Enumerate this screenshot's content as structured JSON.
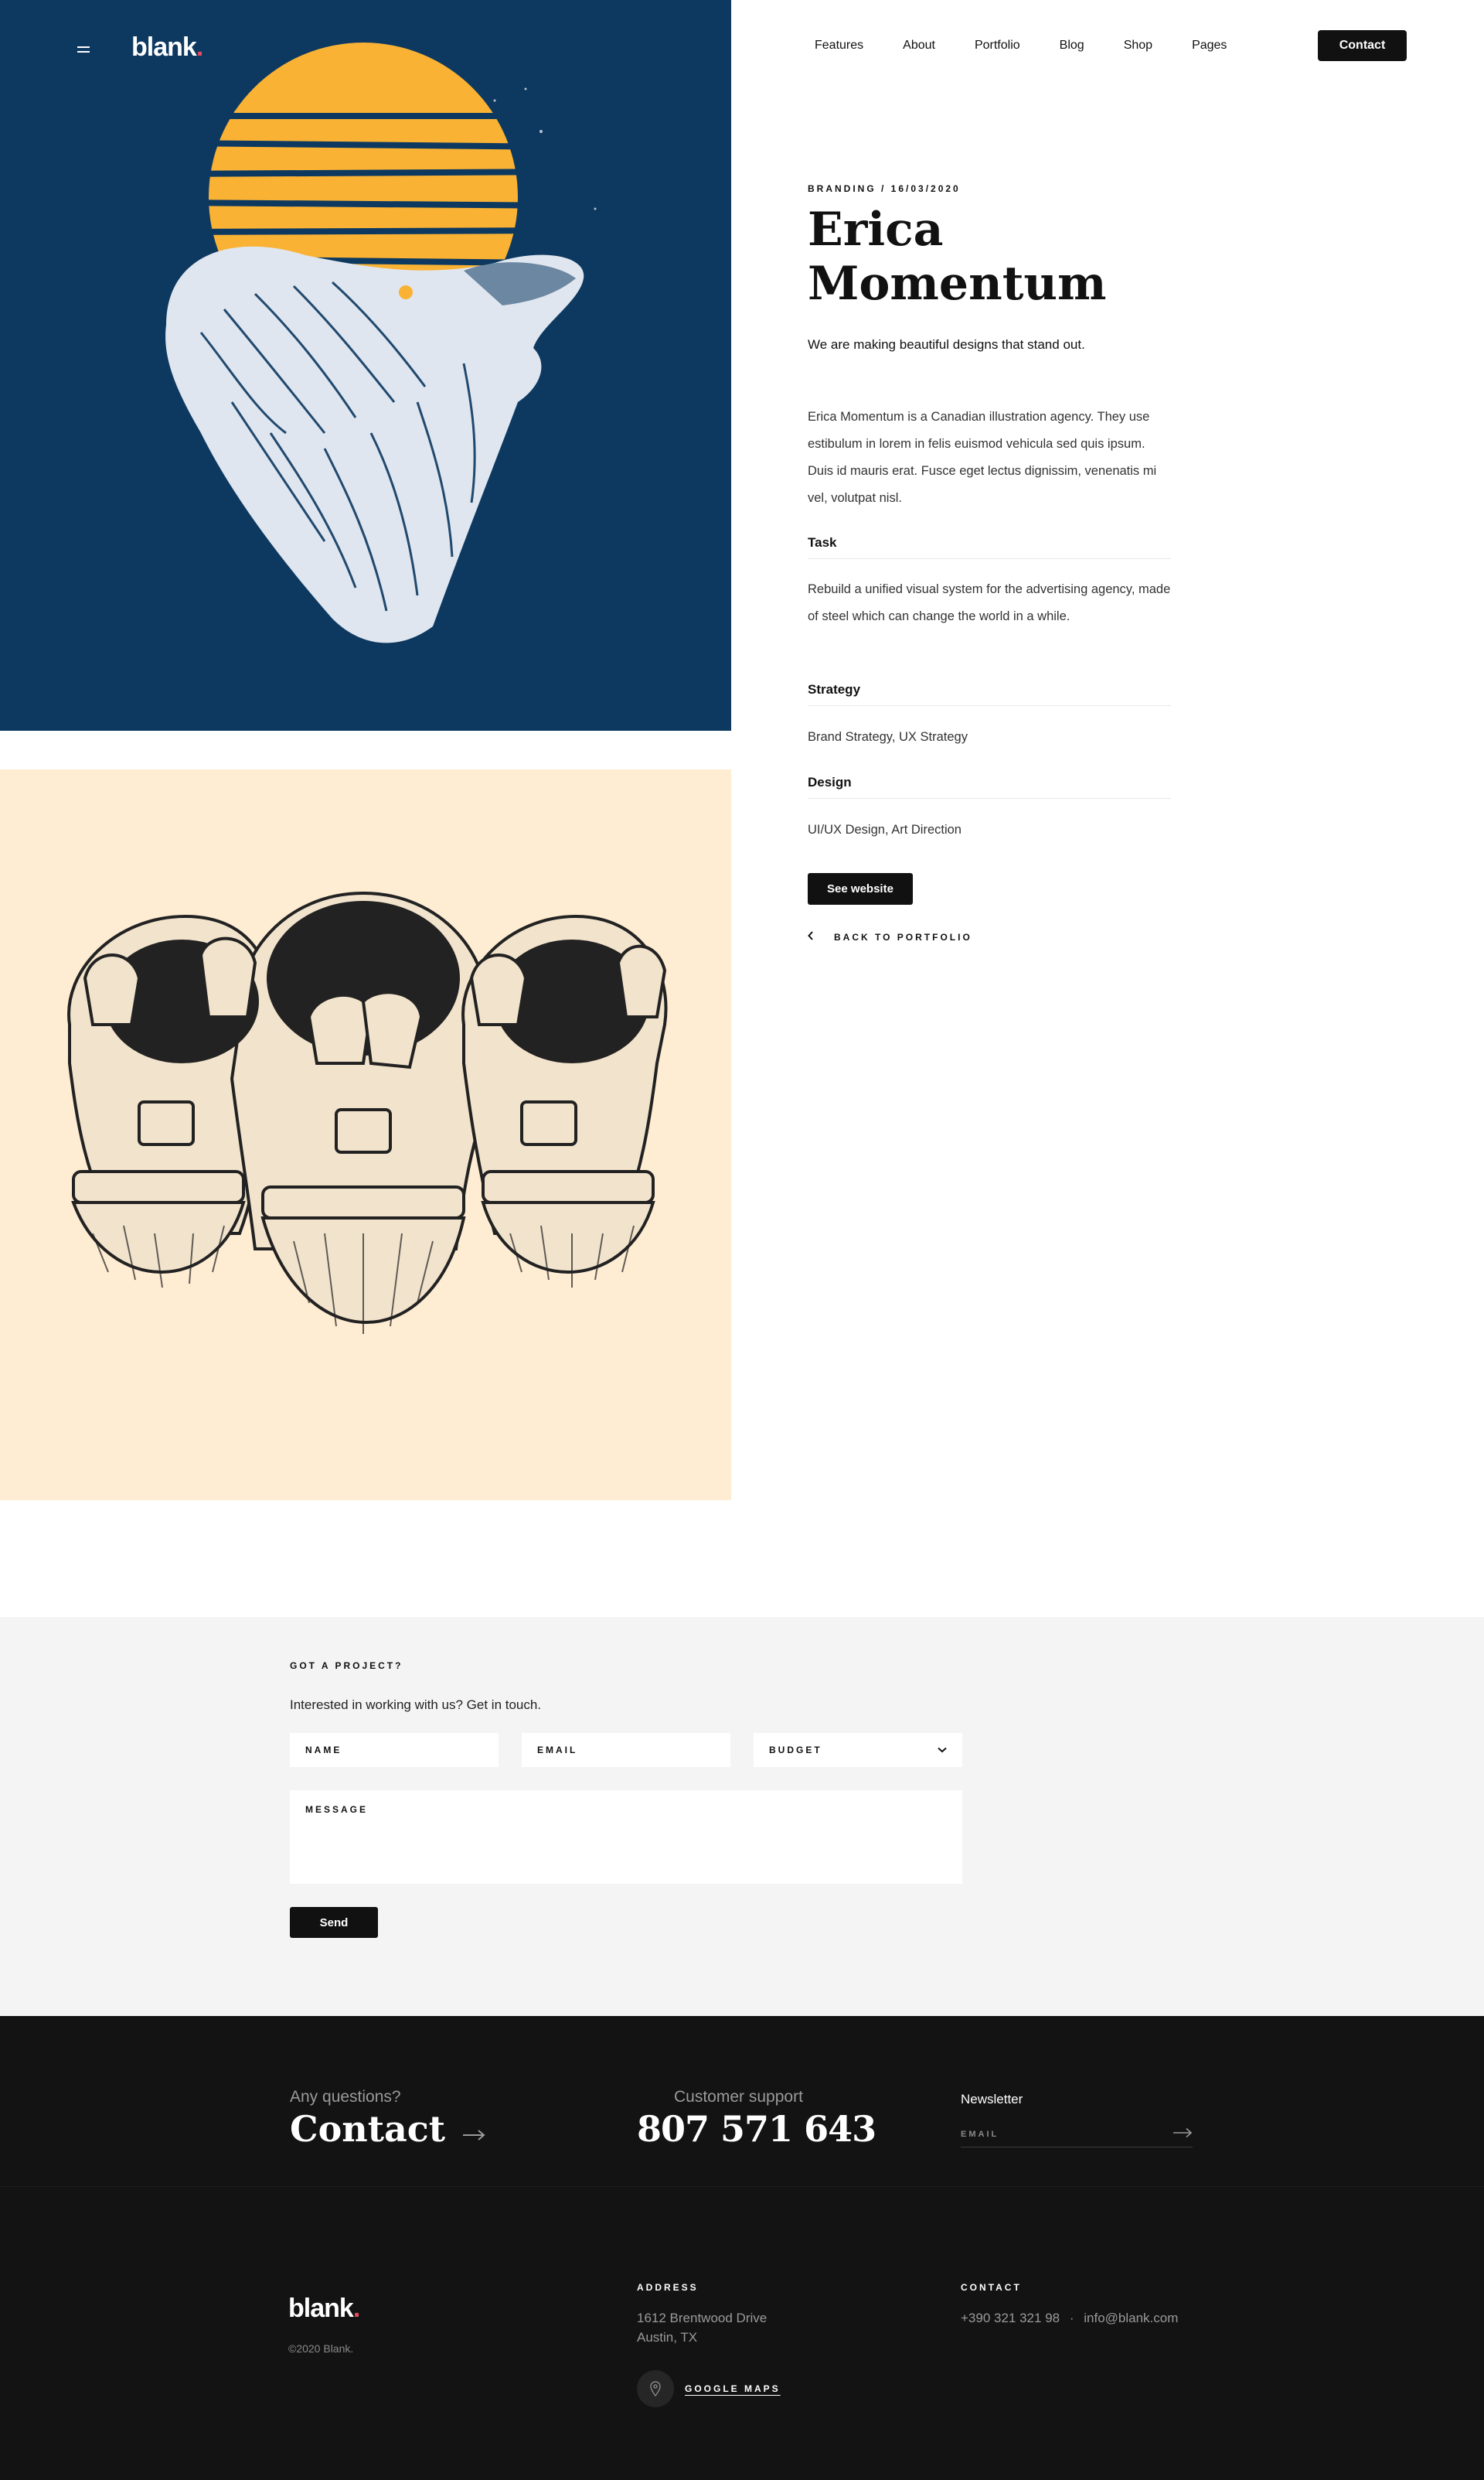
{
  "header": {
    "logo": "blank",
    "logo_dot": ".",
    "nav": [
      "Features",
      "About",
      "Portfolio",
      "Blog",
      "Shop",
      "Pages"
    ],
    "contact_label": "Contact"
  },
  "images": {
    "first": "wolf-moon-illustration",
    "second": "three-astronauts-illustration",
    "first_bg": "#0d3961",
    "second_bg": "#feecd3",
    "sun_color": "#f9b233"
  },
  "project": {
    "meta": "BRANDING / 16/03/2020",
    "title": "Erica Momentum",
    "subtitle": "We are making beautiful designs that stand out.",
    "description": "Erica Momentum is a Canadian illustration agency. They use estibulum in lorem in felis euismod vehicula sed quis ipsum. Duis id mauris erat. Fusce eget lectus dignissim, venenatis mi vel, volutpat nisl.",
    "task_title": "Task",
    "task_text": "Rebuild a unified visual system for the advertising agency, made of steel which can change the world in a while.",
    "strategy_title": "Strategy",
    "strategy_text": "Brand Strategy, UX Strategy",
    "design_title": "Design",
    "design_text": "UI/UX Design, Art Direction",
    "see_website": "See website",
    "back": "BACK TO PORTFOLIO"
  },
  "form": {
    "kicker": "GOT A PROJECT?",
    "intro": "Interested in working with us? Get in touch.",
    "name": "NAME",
    "email": "EMAIL",
    "budget": "BUDGET",
    "message": "MESSAGE",
    "send": "Send"
  },
  "footer": {
    "any_questions": "Any questions?",
    "contact": "Contact",
    "support_label": "Customer support",
    "phone": "807 571 643",
    "newsletter": "Newsletter",
    "newsletter_placeholder": "EMAIL",
    "logo": "blank",
    "copyright": "©2020 Blank.",
    "address_label": "ADDRESS",
    "address_line1": "1612  Brentwood Drive",
    "address_line2": "Austin, TX",
    "maps": "GOOGLE MAPS",
    "contact_label": "CONTACT",
    "contact_phone": "+390 321 321 98",
    "contact_sep": "·",
    "contact_email": "info@blank.com"
  }
}
